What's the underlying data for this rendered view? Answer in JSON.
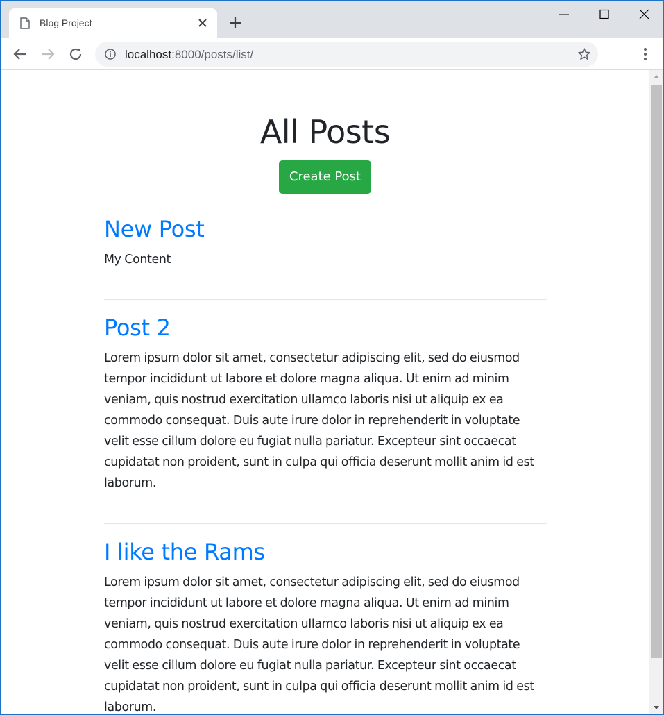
{
  "browser": {
    "tab_title": "Blog Project",
    "url_host": "localhost",
    "url_rest": ":8000/posts/list/"
  },
  "page": {
    "title": "All Posts",
    "create_button": "Create Post"
  },
  "posts": [
    {
      "title": "New Post",
      "content": "My Content"
    },
    {
      "title": "Post 2",
      "content": "Lorem ipsum dolor sit amet, consectetur adipiscing elit, sed do eiusmod tempor incididunt ut labore et dolore magna aliqua. Ut enim ad minim veniam, quis nostrud exercitation ullamco laboris nisi ut aliquip ex ea commodo consequat. Duis aute irure dolor in reprehenderit in voluptate velit esse cillum dolore eu fugiat nulla pariatur. Excepteur sint occaecat cupidatat non proident, sunt in culpa qui officia deserunt mollit anim id est laborum."
    },
    {
      "title": "I like the Rams",
      "content": "Lorem ipsum dolor sit amet, consectetur adipiscing elit, sed do eiusmod tempor incididunt ut labore et dolore magna aliqua. Ut enim ad minim veniam, quis nostrud exercitation ullamco laboris nisi ut aliquip ex ea commodo consequat. Duis aute irure dolor in reprehenderit in voluptate velit esse cillum dolore eu fugiat nulla pariatur. Excepteur sint occaecat cupidatat non proident, sunt in culpa qui officia deserunt mollit anim id est laborum."
    }
  ],
  "colors": {
    "link": "#007bff",
    "button": "#28a745",
    "text": "#212529"
  }
}
